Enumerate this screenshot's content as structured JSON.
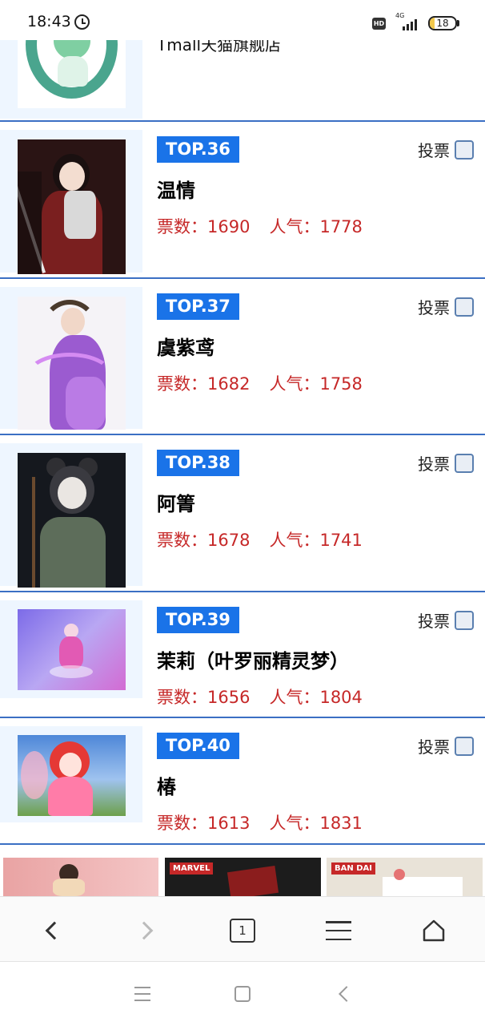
{
  "status_bar": {
    "time": "18:43",
    "network": "4G",
    "hd": "HD",
    "battery": "18",
    "battery_level": 0.18
  },
  "top_card": {
    "store_name": "Tmall天猫旗舰店"
  },
  "items": [
    {
      "rank": "TOP.36",
      "name": "温情",
      "votes_label": "票数：1690",
      "popularity_label": "人气：1778",
      "vote_label": "投票"
    },
    {
      "rank": "TOP.37",
      "name": "虞紫鸢",
      "votes_label": "票数：1682",
      "popularity_label": "人气：1758",
      "vote_label": "投票"
    },
    {
      "rank": "TOP.38",
      "name": "阿箐",
      "votes_label": "票数：1678",
      "popularity_label": "人气：1741",
      "vote_label": "投票"
    },
    {
      "rank": "TOP.39",
      "name": "茉莉（叶罗丽精灵梦）",
      "votes_label": "票数：1656",
      "popularity_label": "人气：1804",
      "vote_label": "投票"
    },
    {
      "rank": "TOP.40",
      "name": "椿",
      "votes_label": "票数：1613",
      "popularity_label": "人气：1831",
      "vote_label": "投票"
    }
  ],
  "banners": {
    "marvel": "MARVEL",
    "bandai": "BAN DAI"
  },
  "browser_toolbar": {
    "tab_count": "1"
  },
  "icons": {
    "back": "chevron-left-icon",
    "forward": "chevron-right-icon",
    "tabs": "tabs-icon",
    "menu": "menu-icon",
    "home": "home-icon"
  }
}
